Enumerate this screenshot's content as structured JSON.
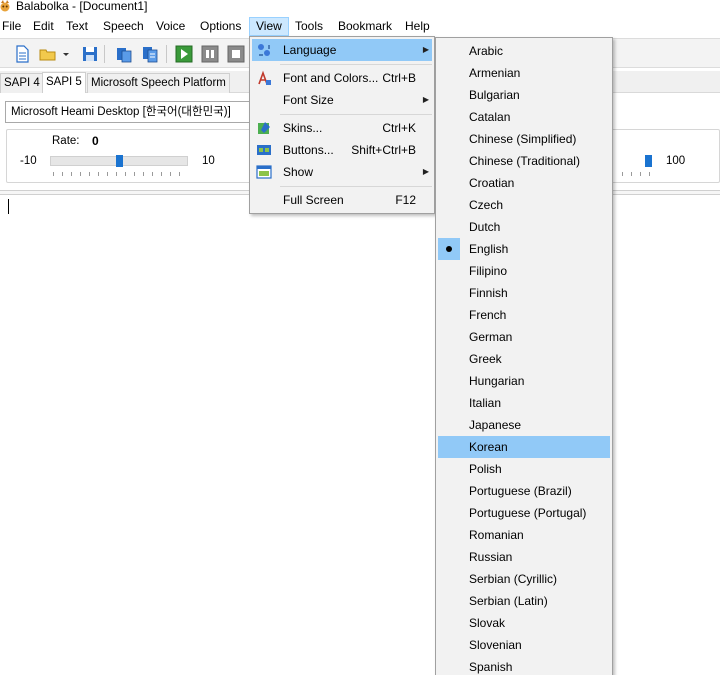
{
  "window": {
    "title": "Balabolka - [Document1]"
  },
  "menubar": [
    "File",
    "Edit",
    "Text",
    "Speech",
    "Voice",
    "Options",
    "View",
    "Tools",
    "Bookmark",
    "Help"
  ],
  "tabs": [
    "SAPI 4",
    "SAPI 5",
    "Microsoft Speech Platform"
  ],
  "voice": {
    "selected": "Microsoft Heami Desktop [한국어(대한민국)]"
  },
  "rate": {
    "label": "Rate:",
    "value": "0",
    "min": "-10",
    "max": "10",
    "level": 0.5
  },
  "volume": {
    "max": "100",
    "level": 1.0
  },
  "view_menu": {
    "items": [
      {
        "label": "Language",
        "shortcut": "",
        "submenu": true,
        "icon": "language-icon",
        "highlighted": true
      },
      {
        "label": "Font and Colors...",
        "shortcut": "Ctrl+B",
        "submenu": false,
        "icon": "font-icon"
      },
      {
        "label": "Font Size",
        "shortcut": "",
        "submenu": true,
        "icon": ""
      },
      {
        "label": "Skins...",
        "shortcut": "Ctrl+K",
        "submenu": false,
        "icon": "skins-icon"
      },
      {
        "label": "Buttons...",
        "shortcut": "Shift+Ctrl+B",
        "submenu": false,
        "icon": "buttons-icon"
      },
      {
        "label": "Show",
        "shortcut": "",
        "submenu": true,
        "icon": "show-icon"
      },
      {
        "label": "Full Screen",
        "shortcut": "F12",
        "submenu": false,
        "icon": ""
      }
    ]
  },
  "language_menu": {
    "selected": "English",
    "highlighted": "Korean",
    "items": [
      "Arabic",
      "Armenian",
      "Bulgarian",
      "Catalan",
      "Chinese (Simplified)",
      "Chinese (Traditional)",
      "Croatian",
      "Czech",
      "Dutch",
      "English",
      "Filipino",
      "Finnish",
      "French",
      "German",
      "Greek",
      "Hungarian",
      "Italian",
      "Japanese",
      "Korean",
      "Polish",
      "Portuguese (Brazil)",
      "Portuguese (Portugal)",
      "Romanian",
      "Russian",
      "Serbian (Cyrillic)",
      "Serbian (Latin)",
      "Slovak",
      "Slovenian",
      "Spanish"
    ]
  }
}
